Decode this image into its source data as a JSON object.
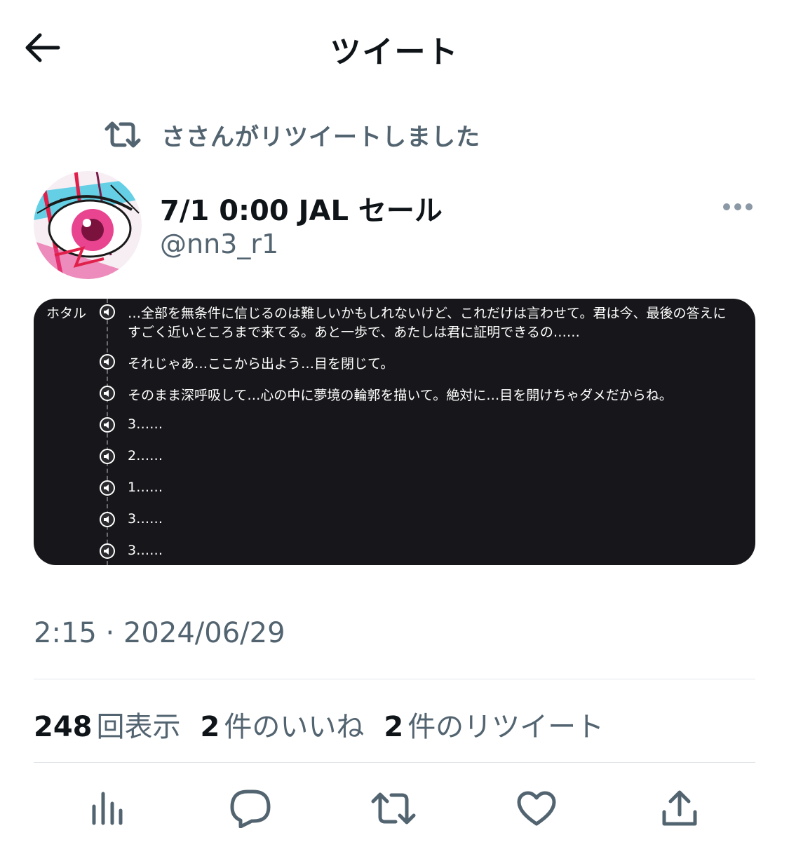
{
  "header": {
    "title": "ツイート",
    "back_icon": "arrow-left-icon"
  },
  "retweet_context": {
    "icon": "retweet-icon",
    "text": "ささんがリツイートしました"
  },
  "tweet": {
    "author": {
      "display_name": "7/1 0:00 JAL セール",
      "handle": "@nn3_r1",
      "avatar": "anime-eye-avatar"
    },
    "more_icon": "more-dots-icon",
    "media": {
      "speaker": "ホタル",
      "icon": "speaker-icon",
      "lines": [
        "…全部を無条件に信じるのは難しいかもしれないけど、これだけは言わせて。君は今、最後の答えに",
        "すごく近いところまで来てる。あと一歩で、あたしは君に証明できるの……",
        "それじゃあ…ここから出よう…目を閉じて。",
        "そのまま深呼吸して…心の中に夢境の輪郭を描いて。絶対に…目を開けちゃダメだからね。",
        "3……",
        "2……",
        "1……",
        "3……",
        "3……"
      ]
    },
    "timestamp": "2:15 · 2024/06/29",
    "stats": {
      "views_count": "248",
      "views_label": "回表示",
      "likes_count": "2",
      "likes_label": "件のいいね",
      "retweets_count": "2",
      "retweets_label": "件のリツイート"
    }
  },
  "actions": {
    "icons": [
      "analytics-icon",
      "reply-icon",
      "retweet-icon",
      "like-icon",
      "share-icon"
    ]
  },
  "colors": {
    "text": "#0f1419",
    "secondary": "#536471",
    "divider": "#e1e6ea",
    "media_bg": "#17171b"
  }
}
